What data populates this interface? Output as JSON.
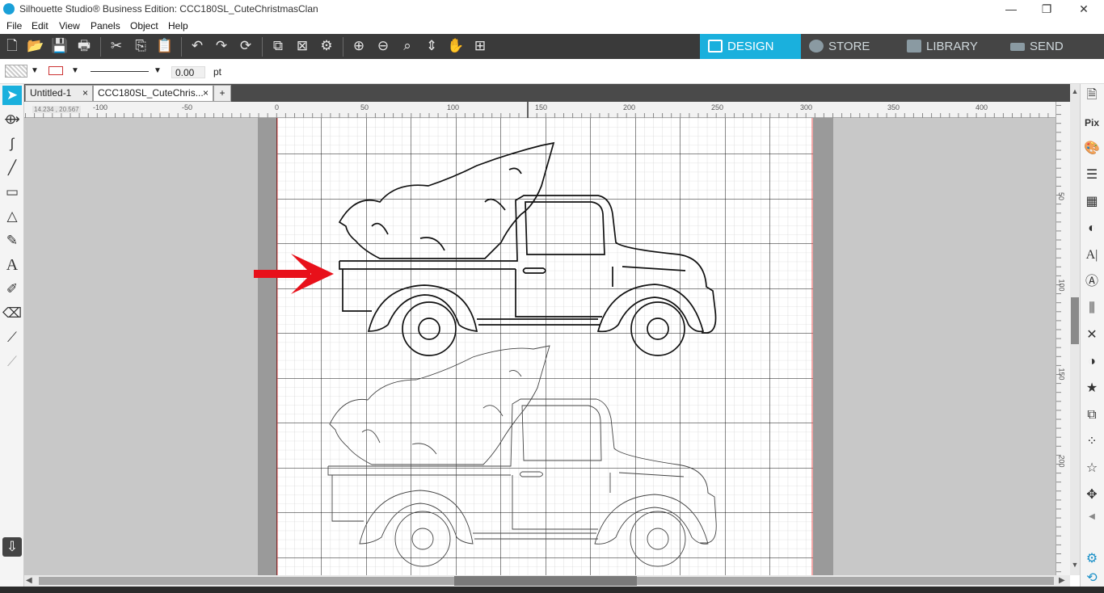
{
  "window": {
    "title": "Silhouette Studio® Business Edition: CCC180SL_CuteChristmasClan",
    "minimize": "—",
    "restore": "❐",
    "close": "✕"
  },
  "menu": [
    "File",
    "Edit",
    "View",
    "Panels",
    "Object",
    "Help"
  ],
  "nav_tabs": [
    {
      "label": "DESIGN",
      "icon": "grid-icon",
      "active": true
    },
    {
      "label": "STORE",
      "icon": "silhouette-s-icon",
      "active": false
    },
    {
      "label": "LIBRARY",
      "icon": "download-icon",
      "active": false
    },
    {
      "label": "SEND",
      "icon": "cutter-icon",
      "active": false
    }
  ],
  "properties": {
    "line_width_value": "0.00",
    "line_width_unit": "pt"
  },
  "doc_tabs": [
    {
      "label": "Untitled-1",
      "close": "×"
    },
    {
      "label": "CCC180SL_CuteChris...",
      "close": "×"
    }
  ],
  "add_tab": "+",
  "ruler": {
    "h_labels": [
      "-100",
      "-50",
      "0",
      "50",
      "100",
      "150",
      "200",
      "250",
      "300",
      "350",
      "400"
    ],
    "v_labels": [
      "50",
      "100",
      "150",
      "200"
    ],
    "coords": "14.234 , 20.567"
  },
  "colors": {
    "accent": "#1ab0dd",
    "toolbar": "#3a3a3a",
    "arrow": "#e8101a",
    "cut_border": "#e05050"
  }
}
